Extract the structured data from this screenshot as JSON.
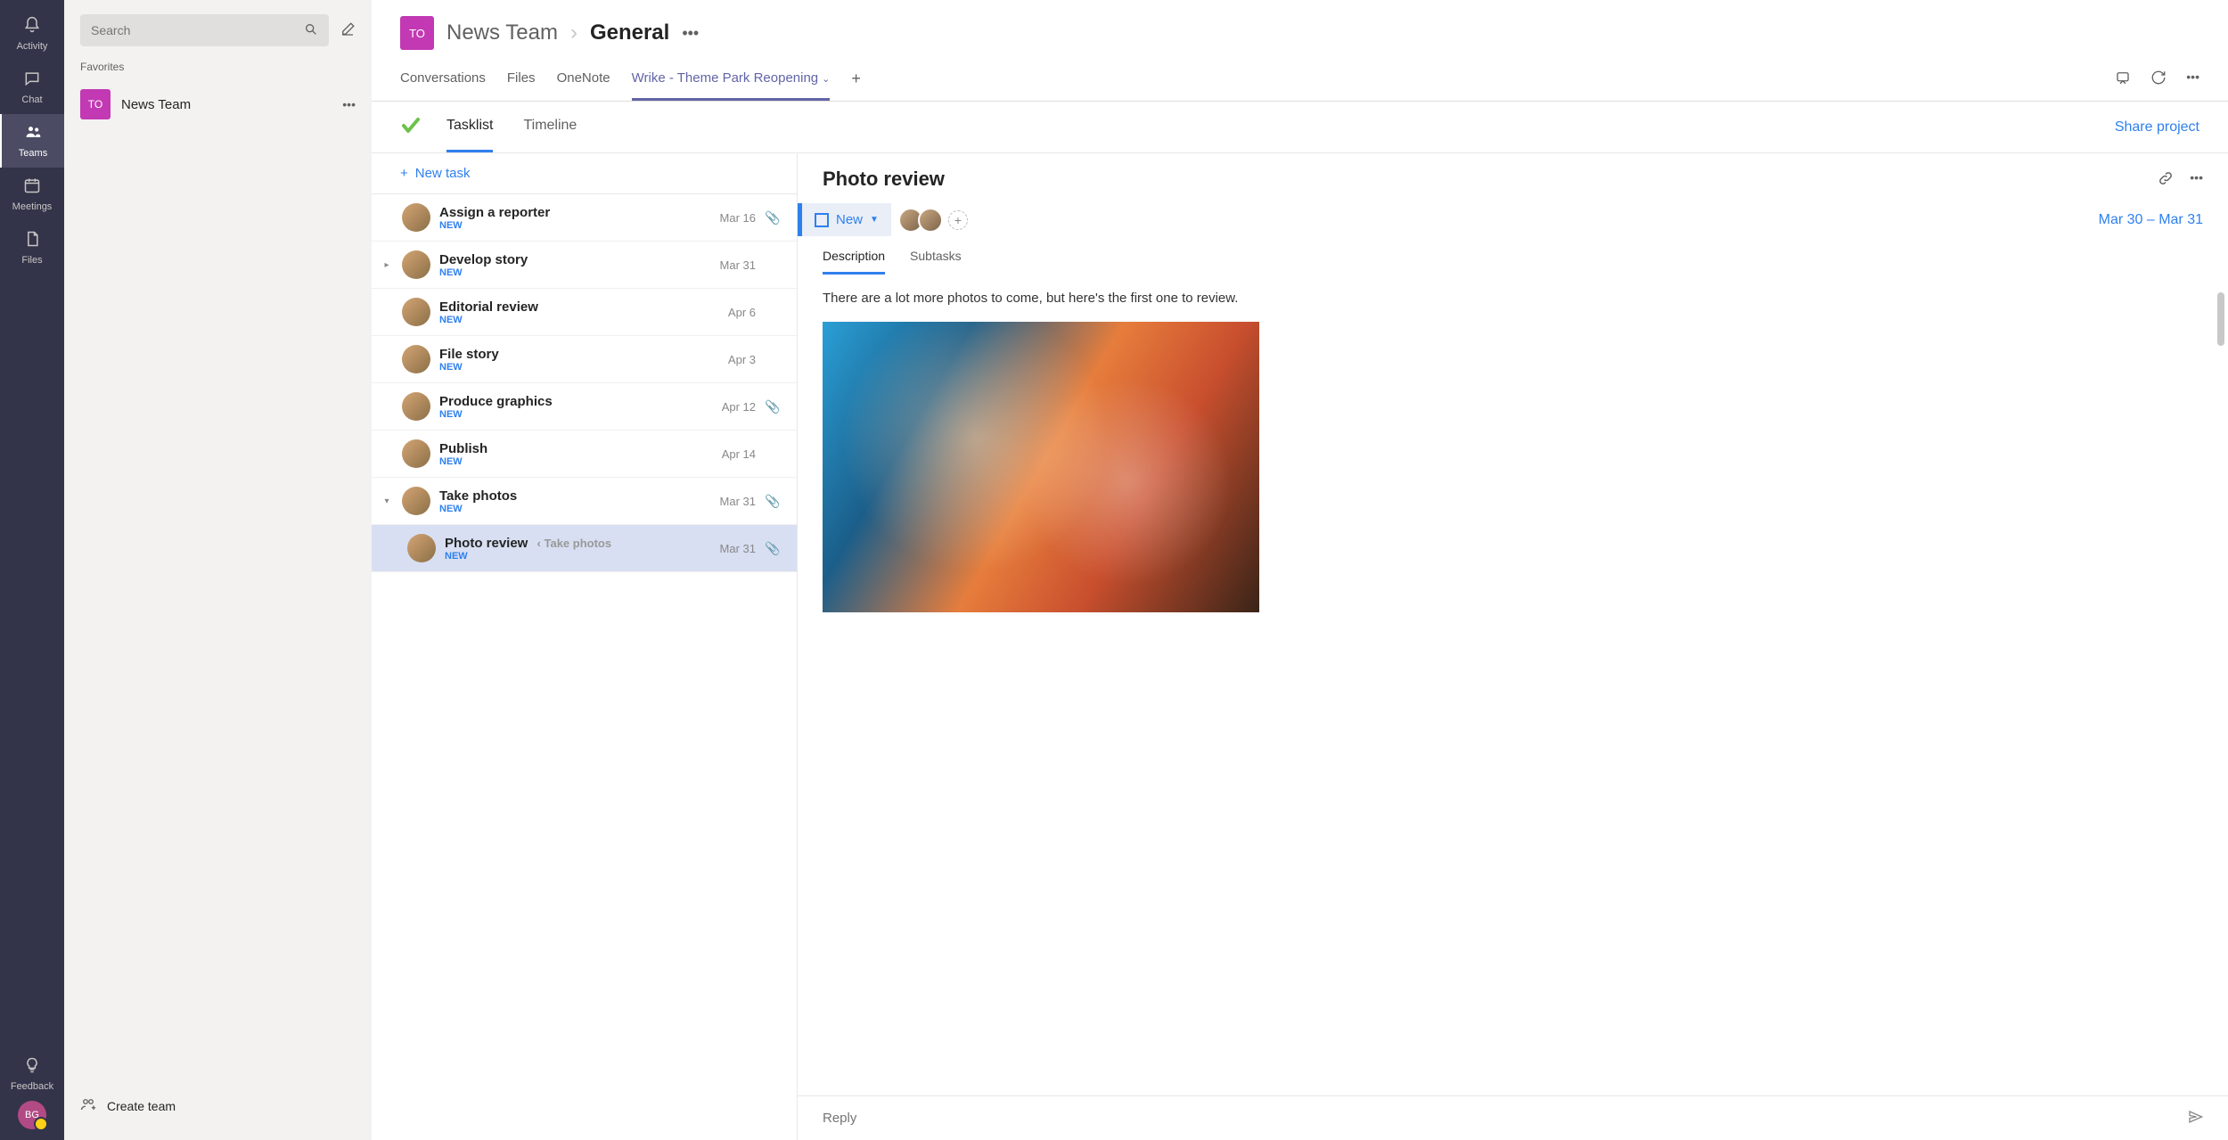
{
  "rail": {
    "items": [
      {
        "label": "Activity",
        "icon": "🔔"
      },
      {
        "label": "Chat",
        "icon": "💬"
      },
      {
        "label": "Teams",
        "icon": "👥"
      },
      {
        "label": "Meetings",
        "icon": "📅"
      },
      {
        "label": "Files",
        "icon": "📄"
      }
    ],
    "feedback": "Feedback",
    "avatar_initials": "BG"
  },
  "team_panel": {
    "search_placeholder": "Search",
    "favorites_label": "Favorites",
    "teams": [
      {
        "initials": "TO",
        "name": "News Team"
      }
    ],
    "create_team": "Create team"
  },
  "channel": {
    "avatar_initials": "TO",
    "team_name": "News Team",
    "channel_name": "General",
    "tabs": [
      "Conversations",
      "Files",
      "OneNote",
      "Wrike - Theme Park Reopening"
    ],
    "active_tab": 3
  },
  "wrike": {
    "tabs": [
      "Tasklist",
      "Timeline"
    ],
    "active_tab": 0,
    "share": "Share project",
    "new_task": "New task",
    "tasks": [
      {
        "title": "Assign a reporter",
        "status": "NEW",
        "date": "Mar 16",
        "clip": true
      },
      {
        "title": "Develop story",
        "status": "NEW",
        "date": "Mar 31",
        "expand": "▸"
      },
      {
        "title": "Editorial review",
        "status": "NEW",
        "date": "Apr 6"
      },
      {
        "title": "File story",
        "status": "NEW",
        "date": "Apr 3"
      },
      {
        "title": "Produce graphics",
        "status": "NEW",
        "date": "Apr 12",
        "clip": true
      },
      {
        "title": "Publish",
        "status": "NEW",
        "date": "Apr 14"
      },
      {
        "title": "Take photos",
        "status": "NEW",
        "date": "Mar 31",
        "clip": true,
        "expand": "▾"
      }
    ],
    "subtask": {
      "title": "Photo review",
      "status": "NEW",
      "date": "Mar 31",
      "clip": true,
      "parent": "Take photos"
    }
  },
  "detail": {
    "title": "Photo review",
    "status": "New",
    "dates": "Mar 30 – Mar 31",
    "tabs": [
      "Description",
      "Subtasks"
    ],
    "active_tab": 0,
    "description": "There are a lot more photos to come, but here's the first one to review.",
    "reply_placeholder": "Reply"
  }
}
